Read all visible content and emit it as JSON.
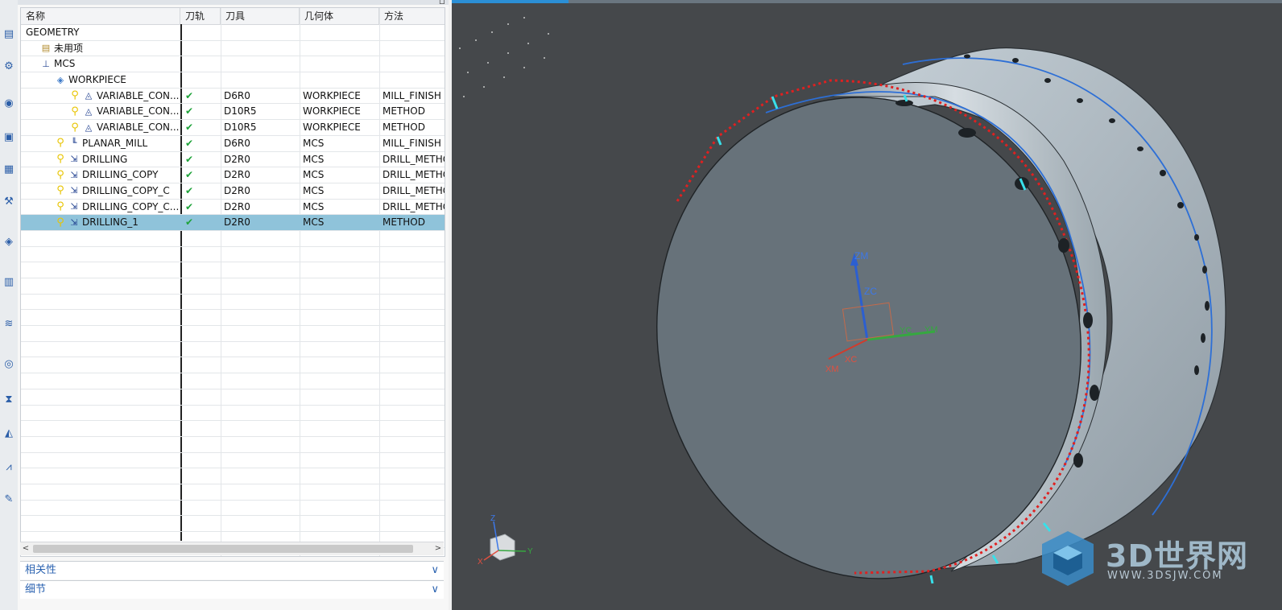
{
  "toolbar": {
    "icons": [
      "program-order-icon",
      "machine-tool-icon",
      "method-icon",
      "geometry-icon",
      "create-program-icon",
      "create-tool-icon",
      "create-geometry-icon",
      "create-operation-icon",
      "generate-toolpath-icon",
      "verify-icon",
      "post-process-icon",
      "shop-doc-icon",
      "machine-sim-icon",
      "feeds-icon"
    ]
  },
  "navigator": {
    "columns": {
      "name": "名称",
      "toolpath": "刀轨",
      "tool": "刀具",
      "geometry": "几何体",
      "method": "方法"
    },
    "rows": [
      {
        "name": "GEOMETRY",
        "toolpath": "",
        "tool": "",
        "geometry": "",
        "method": "",
        "icon": "none",
        "level": 0
      },
      {
        "name": "未用项",
        "toolpath": "",
        "tool": "",
        "geometry": "",
        "method": "",
        "icon": "folder",
        "level": 1
      },
      {
        "name": "MCS",
        "toolpath": "",
        "tool": "",
        "geometry": "",
        "method": "",
        "icon": "mcs",
        "level": 1
      },
      {
        "name": "WORKPIECE",
        "toolpath": "",
        "tool": "",
        "geometry": "",
        "method": "",
        "icon": "workpiece",
        "level": 2
      },
      {
        "name": "VARIABLE_CON...",
        "toolpath": "✔",
        "tool": "D6R0",
        "geometry": "WORKPIECE",
        "method": "MILL_FINISH",
        "icon": "contour",
        "level": 3
      },
      {
        "name": "VARIABLE_CON...",
        "toolpath": "✔",
        "tool": "D10R5",
        "geometry": "WORKPIECE",
        "method": "METHOD",
        "icon": "contour",
        "level": 3
      },
      {
        "name": "VARIABLE_CON...",
        "toolpath": "✔",
        "tool": "D10R5",
        "geometry": "WORKPIECE",
        "method": "METHOD",
        "icon": "contour",
        "level": 3
      },
      {
        "name": "PLANAR_MILL",
        "toolpath": "✔",
        "tool": "D6R0",
        "geometry": "MCS",
        "method": "MILL_FINISH",
        "icon": "planar",
        "level": 2
      },
      {
        "name": "DRILLING",
        "toolpath": "✔",
        "tool": "D2R0",
        "geometry": "MCS",
        "method": "DRILL_METHO",
        "icon": "drill",
        "level": 2
      },
      {
        "name": "DRILLING_COPY",
        "toolpath": "✔",
        "tool": "D2R0",
        "geometry": "MCS",
        "method": "DRILL_METHO",
        "icon": "drill",
        "level": 2
      },
      {
        "name": "DRILLING_COPY_C",
        "toolpath": "✔",
        "tool": "D2R0",
        "geometry": "MCS",
        "method": "DRILL_METHO",
        "icon": "drill",
        "level": 2
      },
      {
        "name": "DRILLING_COPY_C...",
        "toolpath": "✔",
        "tool": "D2R0",
        "geometry": "MCS",
        "method": "DRILL_METHO",
        "icon": "drill",
        "level": 2
      },
      {
        "name": "DRILLING_1",
        "toolpath": "✔",
        "tool": "D2R0",
        "geometry": "MCS",
        "method": "METHOD",
        "icon": "drill",
        "level": 2,
        "selected": true
      }
    ],
    "empty_rows": 20
  },
  "panels": {
    "dependencies": "相关性",
    "details": "细节"
  },
  "viewport": {
    "axis_labels": {
      "zm": "ZM",
      "zc": "ZC",
      "xc": "XC",
      "xm": "XM",
      "yc": "YC",
      "ym": "YM"
    },
    "triad_labels": {
      "z": "Z",
      "y": "Y",
      "x": "X"
    },
    "watermark": {
      "brand": "3D世界网",
      "url": "WWW.3DSJW.COM"
    }
  },
  "colors": {
    "selected_row": "#8fc3da",
    "check_green": "#1fa33a",
    "panel_blue": "#2a62b0",
    "viewport_bg": "#45484b",
    "part_face": "#67727a",
    "toolpath_blue": "#2d6fd6",
    "toolpath_red": "#e02020"
  }
}
